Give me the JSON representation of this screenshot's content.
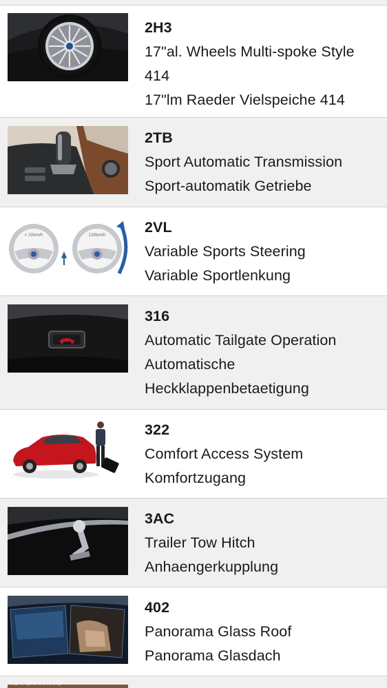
{
  "options": [
    {
      "code": "2H3",
      "name_en": "17\"al. Wheels Multi-spoke Style 414",
      "name_de": "17\"lm Raeder Vielspeiche 414"
    },
    {
      "code": "2TB",
      "name_en": "Sport Automatic Transmission",
      "name_de": "Sport-automatik Getriebe"
    },
    {
      "code": "2VL",
      "name_en": "Variable Sports Steering",
      "name_de": "Variable Sportlenkung"
    },
    {
      "code": "316",
      "name_en": "Automatic Tailgate Operation",
      "name_de": "Automatische Heckklappenbetaetigung"
    },
    {
      "code": "322",
      "name_en": "Comfort Access System",
      "name_de": "Komfortzugang"
    },
    {
      "code": "3AC",
      "name_en": "Trailer Tow Hitch",
      "name_de": "Anhaengerkupplung"
    },
    {
      "code": "402",
      "name_en": "Panorama Glass Roof",
      "name_de": "Panorama Glasdach"
    }
  ],
  "steering_labels": {
    "slow": "< 20km/h",
    "fast": "130km/h"
  },
  "watermark": "AUTOVIT.RO",
  "colors": {
    "row_alt_bg": "#f0f0f1",
    "row_border": "#cfcfcf",
    "text": "#1a1a1a"
  }
}
